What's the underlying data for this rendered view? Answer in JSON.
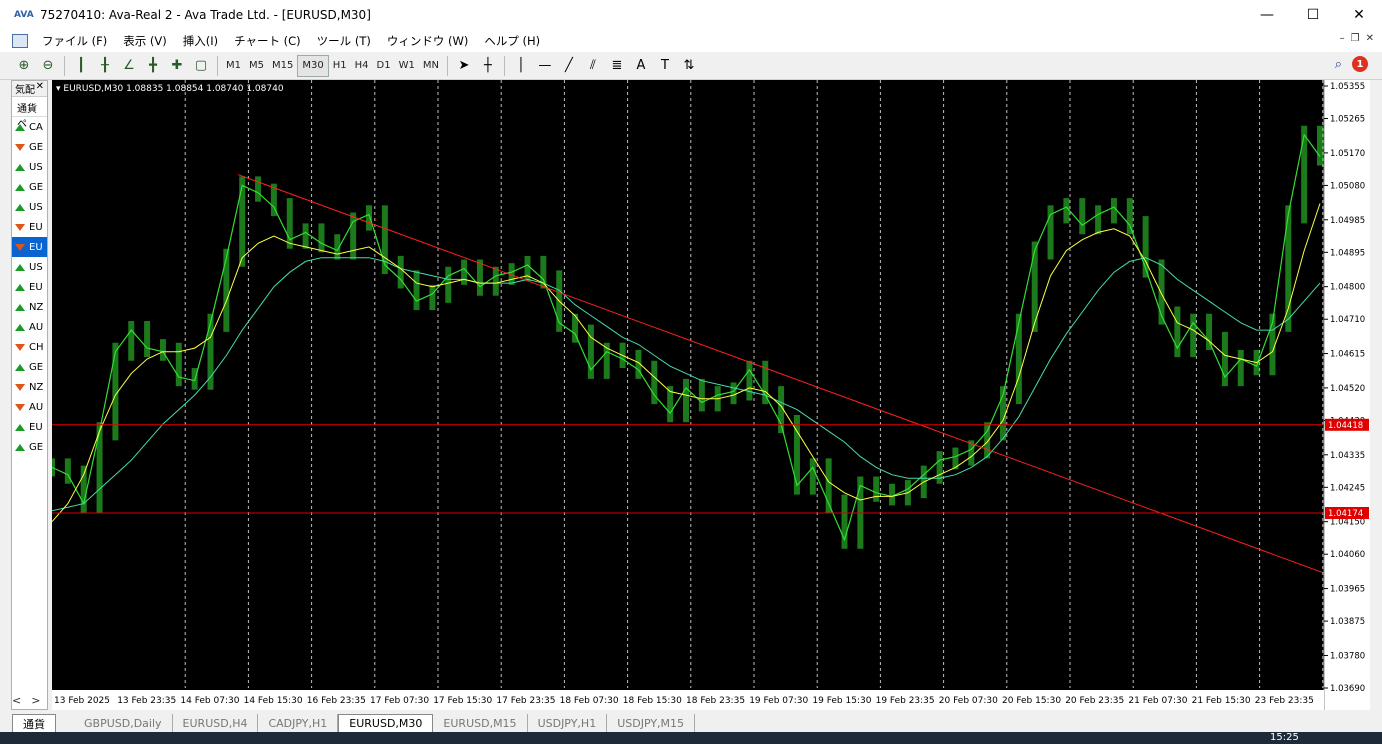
{
  "window": {
    "title": "75270410: Ava-Real 2 - Ava Trade Ltd. - [EURUSD,M30]"
  },
  "menu": [
    "ファイル (F)",
    "表示 (V)",
    "挿入(I)",
    "チャート (C)",
    "ツール (T)",
    "ウィンドウ (W)",
    "ヘルプ (H)"
  ],
  "toolbar": {
    "timeframes": [
      "M1",
      "M5",
      "M15",
      "M30",
      "H1",
      "H4",
      "D1",
      "W1",
      "MN"
    ],
    "active_tf": "M30",
    "notif_count": "1"
  },
  "sidebar": {
    "header": "気配",
    "subheader": "通貨ペ",
    "items": [
      {
        "label": "CA",
        "dir": "up"
      },
      {
        "label": "GE",
        "dir": "dn"
      },
      {
        "label": "US",
        "dir": "up"
      },
      {
        "label": "GE",
        "dir": "up"
      },
      {
        "label": "US",
        "dir": "up"
      },
      {
        "label": "EU",
        "dir": "dn"
      },
      {
        "label": "EU",
        "dir": "dn",
        "selected": true
      },
      {
        "label": "US",
        "dir": "up"
      },
      {
        "label": "EU",
        "dir": "up"
      },
      {
        "label": "NZ",
        "dir": "up"
      },
      {
        "label": "AU",
        "dir": "up"
      },
      {
        "label": "CH",
        "dir": "dn"
      },
      {
        "label": "GE",
        "dir": "up"
      },
      {
        "label": "NZ",
        "dir": "dn"
      },
      {
        "label": "AU",
        "dir": "dn"
      },
      {
        "label": "EU",
        "dir": "up"
      },
      {
        "label": "GE",
        "dir": "up"
      }
    ],
    "bottom_tab": "通貨"
  },
  "chart_info": "EURUSD,M30  1.08835 1.08854 1.08740 1.08740",
  "chart_data": {
    "type": "line",
    "symbol": "EURUSD",
    "timeframe": "M30",
    "ylim": [
      1.0369,
      1.05355
    ],
    "y_ticks": [
      "1.05355",
      "1.05265",
      "1.05170",
      "1.05080",
      "1.04985",
      "1.04895",
      "1.04800",
      "1.04710",
      "1.04615",
      "1.04520",
      "1.04430",
      "1.04335",
      "1.04245",
      "1.04150",
      "1.04060",
      "1.03965",
      "1.03875",
      "1.03780",
      "1.03690"
    ],
    "x_ticks": [
      "13 Feb 2025",
      "13 Feb 23:35",
      "14 Feb 07:30",
      "14 Feb 15:30",
      "16 Feb 23:35",
      "17 Feb 07:30",
      "17 Feb 15:30",
      "17 Feb 23:35",
      "18 Feb 07:30",
      "18 Feb 15:30",
      "18 Feb 23:35",
      "19 Feb 07:30",
      "19 Feb 15:30",
      "19 Feb 23:35",
      "20 Feb 07:30",
      "20 Feb 15:30",
      "20 Feb 23:35",
      "21 Feb 07:30",
      "21 Feb 15:30",
      "23 Feb 23:35"
    ],
    "price_series": [
      1.043,
      1.0428,
      1.042,
      1.044,
      1.0462,
      1.0468,
      1.0463,
      1.0462,
      1.0455,
      1.0454,
      1.047,
      1.0488,
      1.0508,
      1.0506,
      1.0502,
      1.0493,
      1.0495,
      1.0492,
      1.049,
      1.0498,
      1.05,
      1.0486,
      1.0482,
      1.0476,
      1.0478,
      1.0483,
      1.0485,
      1.048,
      1.0483,
      1.0484,
      1.0486,
      1.0482,
      1.047,
      1.0467,
      1.0457,
      1.0462,
      1.046,
      1.0457,
      1.045,
      1.0445,
      1.0452,
      1.0448,
      1.045,
      1.0451,
      1.0457,
      1.045,
      1.0442,
      1.0425,
      1.043,
      1.042,
      1.041,
      1.0425,
      1.0423,
      1.0422,
      1.0424,
      1.0428,
      1.0432,
      1.0433,
      1.0435,
      1.044,
      1.045,
      1.047,
      1.049,
      1.05,
      1.0502,
      1.0497,
      1.05,
      1.0502,
      1.0497,
      1.0485,
      1.0472,
      1.0463,
      1.047,
      1.0465,
      1.0455,
      1.046,
      1.0458,
      1.047,
      1.05,
      1.0522,
      1.0516
    ],
    "ma_fast": [
      1.0415,
      1.042,
      1.0428,
      1.044,
      1.045,
      1.0456,
      1.046,
      1.0462,
      1.0462,
      1.0463,
      1.0466,
      1.0476,
      1.0488,
      1.0492,
      1.0494,
      1.0492,
      1.0491,
      1.049,
      1.0489,
      1.049,
      1.0491,
      1.0488,
      1.0485,
      1.0481,
      1.048,
      1.0481,
      1.0482,
      1.0481,
      1.0481,
      1.0482,
      1.0483,
      1.0481,
      1.0476,
      1.0472,
      1.0466,
      1.0463,
      1.0461,
      1.0459,
      1.0455,
      1.0451,
      1.045,
      1.0449,
      1.0449,
      1.045,
      1.0452,
      1.0451,
      1.0447,
      1.044,
      1.0433,
      1.0426,
      1.0423,
      1.0421,
      1.0422,
      1.0422,
      1.0423,
      1.0426,
      1.0428,
      1.043,
      1.0433,
      1.0437,
      1.0443,
      1.0455,
      1.047,
      1.0483,
      1.049,
      1.0493,
      1.0495,
      1.0496,
      1.0494,
      1.0487,
      1.0478,
      1.047,
      1.0468,
      1.0465,
      1.0461,
      1.046,
      1.0459,
      1.0462,
      1.0474,
      1.049,
      1.0503
    ],
    "ma_slow": [
      1.0418,
      1.0419,
      1.042,
      1.0424,
      1.0428,
      1.0432,
      1.0437,
      1.0442,
      1.0446,
      1.045,
      1.0455,
      1.0461,
      1.0468,
      1.0474,
      1.048,
      1.0484,
      1.0487,
      1.0488,
      1.0488,
      1.0488,
      1.0488,
      1.0487,
      1.0485,
      1.0484,
      1.0483,
      1.0482,
      1.0482,
      1.0481,
      1.0481,
      1.0481,
      1.0482,
      1.0481,
      1.0479,
      1.0475,
      1.0472,
      1.0469,
      1.0466,
      1.0464,
      1.0461,
      1.0458,
      1.0456,
      1.0454,
      1.0453,
      1.0452,
      1.0451,
      1.045,
      1.0448,
      1.0446,
      1.0443,
      1.044,
      1.0437,
      1.0433,
      1.043,
      1.0428,
      1.0427,
      1.0427,
      1.0427,
      1.0428,
      1.043,
      1.0433,
      1.0438,
      1.0444,
      1.0452,
      1.046,
      1.0467,
      1.0473,
      1.0479,
      1.0484,
      1.0487,
      1.0488,
      1.0486,
      1.0482,
      1.0479,
      1.0476,
      1.0473,
      1.047,
      1.0468,
      1.0468,
      1.0471,
      1.0476,
      1.0481
    ],
    "trendline": {
      "start": 1.0511,
      "end": 1.0401
    },
    "hlines": [
      {
        "price": 1.04418,
        "label": "1.04418"
      },
      {
        "price": 1.04174,
        "label": "1.04174"
      }
    ],
    "colors": {
      "price": "#33dd33",
      "ma_fast": "#ffff44",
      "ma_slow": "#44ddaa",
      "trend": "#ff2020",
      "hline": "#e00000",
      "grid": "#c0c0c0"
    }
  },
  "bottom_tabs": [
    "GBPUSD,Daily",
    "EURUSD,H4",
    "CADJPY,H1",
    "EURUSD,M30",
    "EURUSD,M15",
    "USDJPY,H1",
    "USDJPY,M15"
  ],
  "active_tab": "EURUSD,M30",
  "taskbar": {
    "time": "15:25"
  }
}
